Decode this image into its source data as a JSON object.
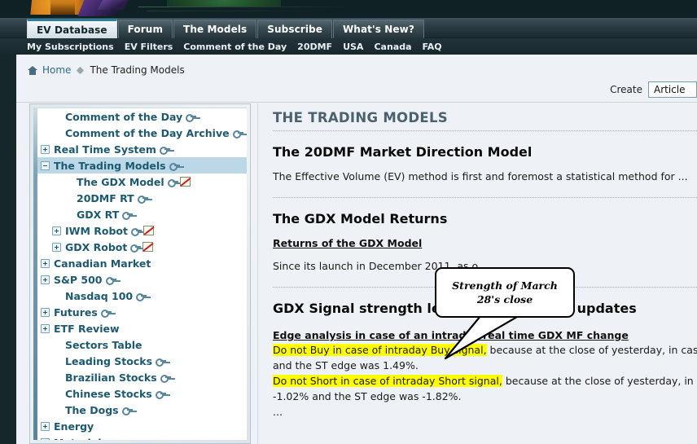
{
  "site": {
    "primary_tabs": [
      {
        "label": "EV Database",
        "active": true
      },
      {
        "label": "Forum",
        "active": false
      },
      {
        "label": "The Models",
        "active": false
      },
      {
        "label": "Subscribe",
        "active": false
      },
      {
        "label": "What's New?",
        "active": false
      }
    ],
    "sub_nav": [
      "My Subscriptions",
      "EV Filters",
      "Comment of the Day",
      "20DMF",
      "USA",
      "Canada",
      "FAQ"
    ]
  },
  "breadcrumb": {
    "home_icon": "home-icon",
    "home_label": "Home",
    "separator_icon": "diamond-separator-icon",
    "current": "The Trading Models"
  },
  "create_row": {
    "label": "Create",
    "selected_option": "Article",
    "options": [
      "Article"
    ]
  },
  "sidebar": {
    "items": [
      {
        "label": "Comment of the Day",
        "indent": 1,
        "toggle": "none",
        "key": true,
        "chart": false,
        "selected": false
      },
      {
        "label": "Comment of the Day Archive",
        "indent": 1,
        "toggle": "none",
        "key": true,
        "chart": false,
        "selected": false
      },
      {
        "label": "Real Time System",
        "indent": 0,
        "toggle": "plus",
        "key": true,
        "chart": false,
        "selected": false
      },
      {
        "label": "The Trading Models",
        "indent": 0,
        "toggle": "minus",
        "key": true,
        "chart": false,
        "selected": true
      },
      {
        "label": "The GDX Model",
        "indent": 2,
        "toggle": "none",
        "key": true,
        "chart": true,
        "selected": false
      },
      {
        "label": "20DMF RT",
        "indent": 2,
        "toggle": "none",
        "key": true,
        "chart": false,
        "selected": false
      },
      {
        "label": "GDX RT",
        "indent": 2,
        "toggle": "none",
        "key": true,
        "chart": false,
        "selected": false
      },
      {
        "label": "IWM Robot",
        "indent": 1,
        "toggle": "plus",
        "key": true,
        "chart": true,
        "selected": false
      },
      {
        "label": "GDX Robot",
        "indent": 1,
        "toggle": "plus",
        "key": true,
        "chart": true,
        "selected": false
      },
      {
        "label": "Canadian Market",
        "indent": 0,
        "toggle": "plus",
        "key": false,
        "chart": false,
        "selected": false
      },
      {
        "label": "S&P 500",
        "indent": 0,
        "toggle": "plus",
        "key": true,
        "chart": false,
        "selected": false
      },
      {
        "label": "Nasdaq 100",
        "indent": 1,
        "toggle": "none",
        "key": true,
        "chart": false,
        "selected": false
      },
      {
        "label": "Futures",
        "indent": 0,
        "toggle": "plus",
        "key": true,
        "chart": false,
        "selected": false
      },
      {
        "label": "ETF Review",
        "indent": 0,
        "toggle": "plus",
        "key": false,
        "chart": false,
        "selected": false
      },
      {
        "label": "Sectors Table",
        "indent": 1,
        "toggle": "none",
        "key": false,
        "chart": false,
        "selected": false
      },
      {
        "label": "Leading Stocks",
        "indent": 1,
        "toggle": "none",
        "key": true,
        "chart": false,
        "selected": false
      },
      {
        "label": "Brazilian Stocks",
        "indent": 1,
        "toggle": "none",
        "key": true,
        "chart": false,
        "selected": false
      },
      {
        "label": "Chinese Stocks",
        "indent": 1,
        "toggle": "none",
        "key": true,
        "chart": false,
        "selected": false
      },
      {
        "label": "The Dogs",
        "indent": 1,
        "toggle": "none",
        "key": true,
        "chart": false,
        "selected": false
      },
      {
        "label": "Energy",
        "indent": 0,
        "toggle": "plus",
        "key": false,
        "chart": false,
        "selected": false
      },
      {
        "label": "Materials",
        "indent": 0,
        "toggle": "plus",
        "key": false,
        "chart": false,
        "selected": false
      }
    ]
  },
  "content": {
    "page_title": "THE TRADING MODELS",
    "section_1": {
      "heading": "The 20DMF Market Direction Model",
      "body": "The Effective Volume (EV) method is first and foremost a statistical method for ..."
    },
    "section_2": {
      "heading": "The GDX Model Returns",
      "link": "Returns of the GDX Model",
      "body": "Since its launch in December 2011, as o"
    },
    "section_3": {
      "heading": "GDX Signal strength levels and real time updates",
      "sub_heading": "Edge analysis in case of an intraday real time GDX MF change",
      "line1_highlight": "Do not Buy in case of intraday Buy signal,",
      "line1_rest": " because at the close of yesterday, in case of a Buy signal",
      "line2": "and the ST edge was 1.49%.",
      "line3_highlight": "Do not Short in case of intraday Short signal,",
      "line3_rest": " because at the close of yesterday, in case of a Short",
      "line4": "-1.02% and the ST edge was -1.82%.",
      "line5": "..."
    }
  },
  "callout": {
    "text": "Strength of March 28's close"
  },
  "colors": {
    "page_background": "#eef2f6",
    "chrome_dark": "#16272b",
    "accent_teal": "#2f7f96",
    "link_blue": "#2a6b92",
    "tree_text": "#1d5a72",
    "tree_selected": "#bcd8e6",
    "highlight_yellow": "#ffff00"
  }
}
